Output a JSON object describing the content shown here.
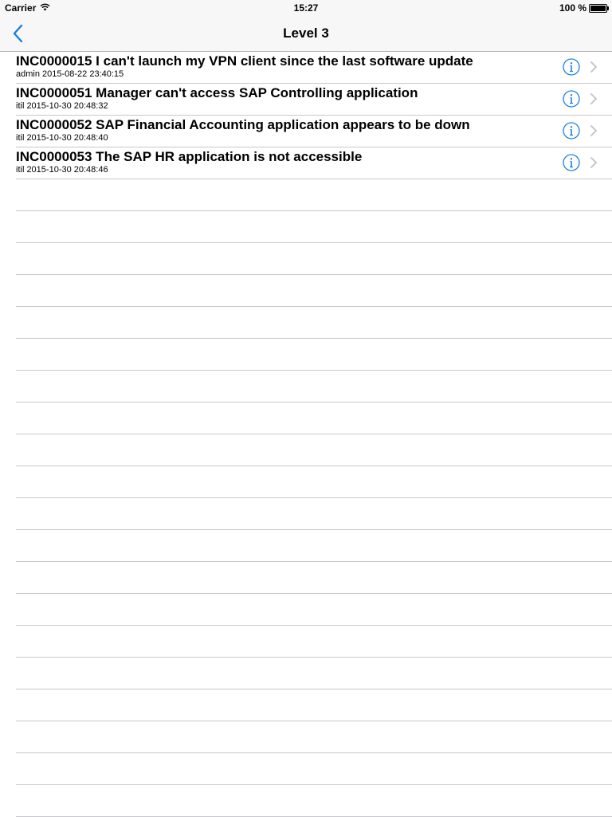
{
  "status_bar": {
    "carrier": "Carrier",
    "time": "15:27",
    "battery": "100 %"
  },
  "nav": {
    "title": "Level 3",
    "back_icon": "chevron-left-icon"
  },
  "colors": {
    "accent": "#1a7fe0",
    "separator": "#c8c7cc",
    "bar_background": "#f7f7f7"
  },
  "incidents": [
    {
      "title": "INC0000015 I can't launch my VPN client since the last software update",
      "subtitle": "admin 2015-08-22 23:40:15"
    },
    {
      "title": "INC0000051 Manager can't access SAP Controlling application",
      "subtitle": "itil 2015-10-30 20:48:32"
    },
    {
      "title": "INC0000052 SAP Financial Accounting application appears to be down",
      "subtitle": "itil 2015-10-30 20:48:40"
    },
    {
      "title": "INC0000053 The SAP HR application is not accessible",
      "subtitle": "itil 2015-10-30 20:48:46"
    }
  ]
}
